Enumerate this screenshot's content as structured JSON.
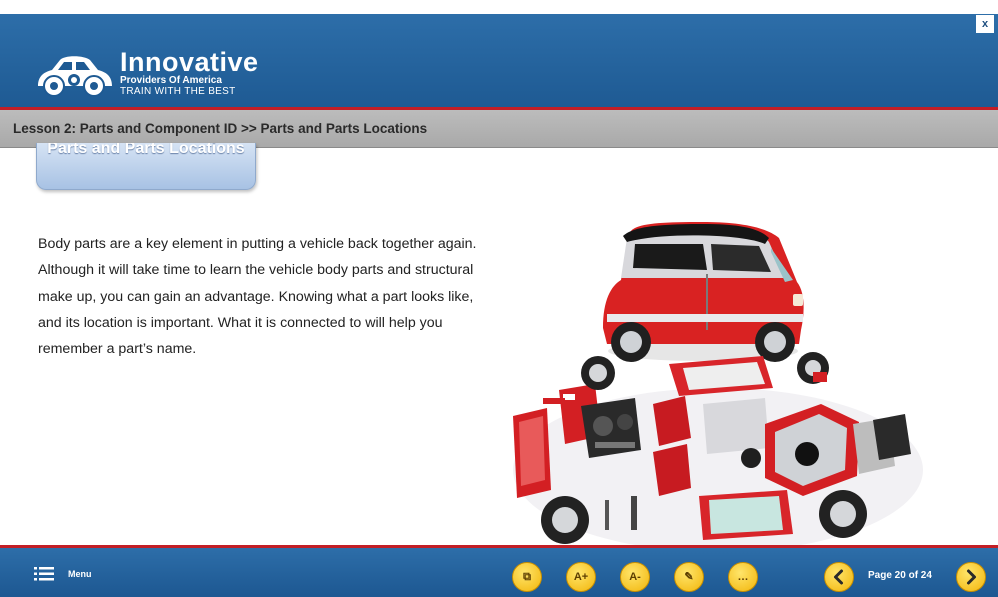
{
  "window": {
    "close_label": "x"
  },
  "header": {
    "brand": "Innovative",
    "tagline_1": "Providers Of America",
    "tagline_2": "TRAIN WITH THE BEST"
  },
  "breadcrumb": {
    "text": "Lesson 2: Parts and Component ID >> Parts and Parts Locations"
  },
  "section_tab": {
    "label": "Parts and Parts Locations"
  },
  "content": {
    "body": "Body parts are a key element in putting a vehicle back together again.  Although it will take time to learn the vehicle body parts and structural make up, you can gain an advantage.  Knowing what a part looks like, and its location is important. What it is connected to will help you remember a part’s name."
  },
  "footer": {
    "menu_label": "Menu",
    "tools": [
      {
        "name": "copy-icon",
        "glyph": "⧉"
      },
      {
        "name": "font-increase-icon",
        "glyph": "A+"
      },
      {
        "name": "font-decrease-icon",
        "glyph": "A-"
      },
      {
        "name": "notes-icon",
        "glyph": "✎"
      },
      {
        "name": "chat-icon",
        "glyph": "…"
      }
    ],
    "prev_icon": "chevron-left-icon",
    "next_icon": "chevron-right-icon",
    "page_label": "Page 20 of 24"
  },
  "colors": {
    "header_blue": "#2462a0",
    "accent_red": "#c21e26",
    "button_yellow": "#f5bf16",
    "breadcrumb_gray": "#b5b5b5"
  }
}
